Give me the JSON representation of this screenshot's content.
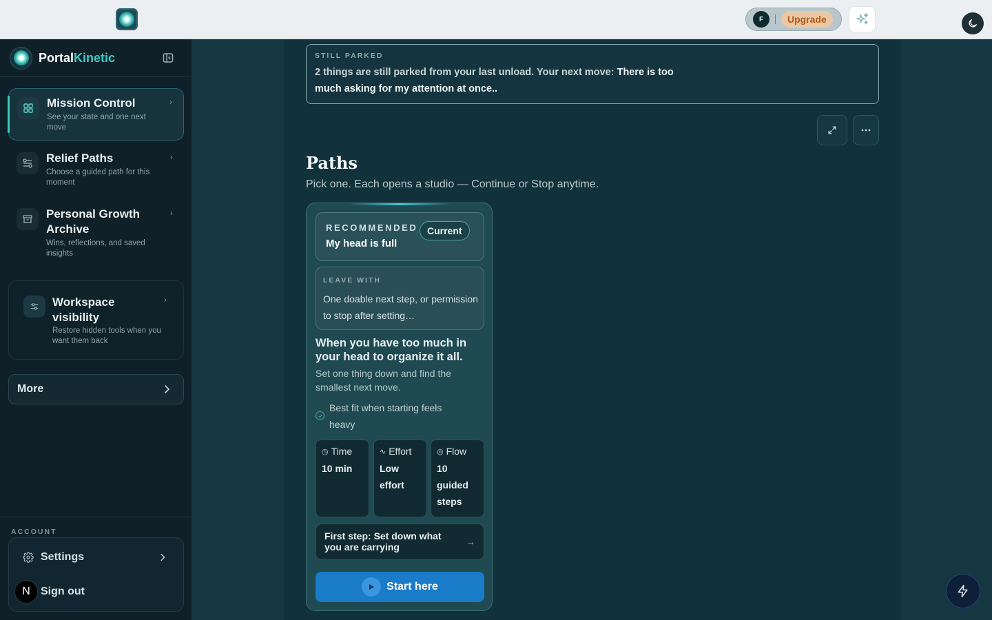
{
  "topbar": {
    "avatar_initial": "F",
    "upgrade_label": "Upgrade"
  },
  "brand": {
    "name_part1": "Portal",
    "name_part2": "Kinetic"
  },
  "sidebar": {
    "items": [
      {
        "title": "Mission Control",
        "subtitle": "See your state and one next move",
        "icon": "grid-icon",
        "active": true
      },
      {
        "title": "Relief Paths",
        "subtitle": "Choose a guided path for this moment",
        "icon": "sliders-icon",
        "active": false
      },
      {
        "title": "Personal Growth Archive",
        "subtitle": "Wins, reflections, and saved insights",
        "icon": "archive-icon",
        "active": false
      }
    ],
    "workspace": {
      "title": "Workspace visibility",
      "subtitle": "Restore hidden tools when you want them back",
      "icon": "settings-sliders-icon"
    },
    "more_label": "More",
    "account_label": "ACCOUNT",
    "settings_label": "Settings",
    "signout_label": "Sign out",
    "signout_avatar": "N"
  },
  "parked": {
    "label": "STILL PARKED",
    "text": "2 things are still parked from your last unload. Your next move: ",
    "highlight": "There is too much asking for my attention at once.."
  },
  "paths": {
    "title": "Paths",
    "subtitle": "Pick one. Each opens a studio — Continue or Stop anytime.",
    "card": {
      "recommended_label": "RECOMMENDED",
      "current_badge": "Current",
      "title": "My head is full",
      "leave_with_label": "LEAVE WITH",
      "leave_with_text": "One doable next step, or permission to stop after setting…",
      "heading": "When you have too much in your head to organize it all.",
      "description": "Set one thing down and find the smallest next move.",
      "fit": "Best fit when starting feels heavy",
      "stats": [
        {
          "label": "Time",
          "value": "10 min",
          "icon": "clock-icon"
        },
        {
          "label": "Effort",
          "value": "Low effort",
          "icon": "pulse-icon"
        },
        {
          "label": "Flow",
          "value": "10 guided steps",
          "icon": "target-icon"
        }
      ],
      "first_step_label": "First step:",
      "first_step_text": "Set down what you are carrying",
      "start_label": "Start here"
    }
  },
  "colors": {
    "accent": "#3ec9c2",
    "primary_button": "#1a7bc9",
    "upgrade_text": "#b35a12"
  }
}
